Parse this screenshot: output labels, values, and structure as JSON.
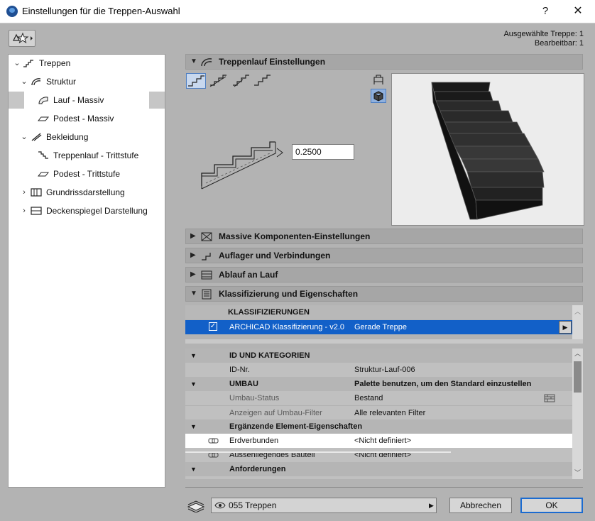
{
  "window": {
    "title": "Einstellungen für die Treppen-Auswahl",
    "help": "?",
    "close": "✕"
  },
  "selection_info": {
    "line1": "Ausgewählte Treppe: 1",
    "line2": "Bearbeitbar: 1"
  },
  "tree": {
    "items": [
      {
        "label": "Treppen",
        "icon": "stair-icon",
        "chevron": "⌄"
      },
      {
        "label": "Struktur",
        "icon": "structure-icon",
        "chevron": "⌄"
      },
      {
        "label": "Lauf - Massiv",
        "icon": "flight-solid-icon"
      },
      {
        "label": "Podest - Massiv",
        "icon": "landing-solid-icon"
      },
      {
        "label": "Bekleidung",
        "icon": "finish-icon",
        "chevron": "⌄"
      },
      {
        "label": "Treppenlauf - Trittstufe",
        "icon": "tread-icon"
      },
      {
        "label": "Podest - Trittstufe",
        "icon": "landing-tread-icon"
      },
      {
        "label": "Grundrissdarstellung",
        "icon": "floorplan-icon",
        "chevron": "›"
      },
      {
        "label": "Deckenspiegel Darstellung",
        "icon": "ceiling-plan-icon",
        "chevron": "›"
      }
    ]
  },
  "sections": {
    "flight": {
      "title": "Treppenlauf Einstellungen",
      "value": "0.2500"
    },
    "solid_components": {
      "title": "Massive Komponenten-Einstellungen"
    },
    "supports": {
      "title": "Auflager und Verbindungen"
    },
    "drainage": {
      "title": "Ablauf an Lauf"
    },
    "classification": {
      "title": "Klassifizierung und Eigenschaften"
    }
  },
  "classification": {
    "header": "KLASSIFIZIERUNGEN",
    "system": "ARCHICAD Klassifizierung - v2.0",
    "value": "Gerade Treppe"
  },
  "properties": {
    "id_header": "ID UND KATEGORIEN",
    "id_label": "ID-Nr.",
    "id_value": "Struktur-Lauf-006",
    "reno_header": "UMBAU",
    "reno_note": "Palette benutzen, um den Standard einzustellen",
    "reno_status_label": "Umbau-Status",
    "reno_status_value": "Bestand",
    "reno_filter_label": "Anzeigen auf Umbau-Filter",
    "reno_filter_value": "Alle relevanten Filter",
    "extra_header": "Ergänzende Element-Eigenschaften",
    "earth_label": "Erdverbunden",
    "earth_value": "<Nicht definiert>",
    "ext_label": "Aussenliegendes Bauteil",
    "ext_value": "<Nicht definiert>",
    "req_header": "Anforderungen"
  },
  "footer": {
    "layer": "055 Treppen",
    "cancel": "Abbrechen",
    "ok": "OK"
  },
  "colors": {
    "selection_blue": "#1260c8",
    "ok_border": "#1b6bd0"
  }
}
